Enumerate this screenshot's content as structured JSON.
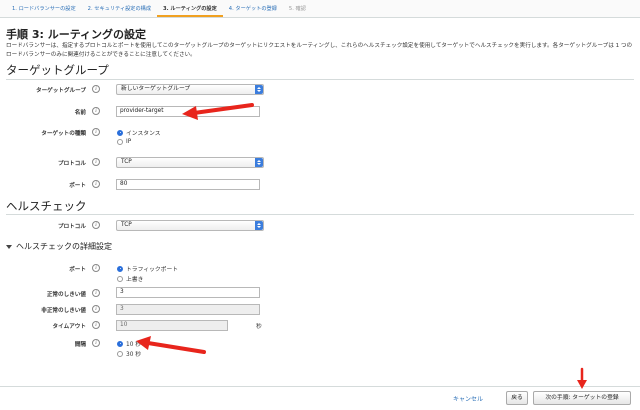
{
  "tabs": [
    {
      "label": "1. ロードバランサーの設定"
    },
    {
      "label": "2. セキュリティ設定の構成"
    },
    {
      "label": "3. ルーティングの設定"
    },
    {
      "label": "4. ターゲットの登録"
    },
    {
      "label": "5. 確認"
    }
  ],
  "page": {
    "title": "手順 3: ルーティングの設定",
    "description": "ロードバランサーは、指定するプロトコルとポートを使用してこのターゲットグループのターゲットにリクエストをルーティングし、これらのヘルスチェック設定を使用してターゲットでヘルスチェックを実行します。各ターゲットグループは 1 つのロードバランサーのみに関連付けることができることに注意してください。"
  },
  "target_group": {
    "section_title": "ターゲットグループ",
    "target_group_label": "ターゲットグループ",
    "target_group_value": "新しいターゲットグループ",
    "name_label": "名前",
    "name_value": "provider-target",
    "target_type_label": "ターゲットの種類",
    "target_type_options": [
      "インスタンス",
      "IP"
    ],
    "protocol_label": "プロトコル",
    "protocol_value": "TCP",
    "port_label": "ポート",
    "port_value": "80"
  },
  "health_check": {
    "section_title": "ヘルスチェック",
    "protocol_label": "プロトコル",
    "protocol_value": "TCP"
  },
  "advanced": {
    "title": "ヘルスチェックの詳細設定",
    "port_label": "ポート",
    "port_options": [
      "トラフィックポート",
      "上書き"
    ],
    "healthy_label": "正常のしきい値",
    "healthy_value": "3",
    "unhealthy_label": "非正常のしきい値",
    "unhealthy_value": "3",
    "timeout_label": "タイムアウト",
    "timeout_value": "10",
    "timeout_unit": "秒",
    "interval_label": "間隔",
    "interval_options": [
      "10 秒",
      "30 秒"
    ]
  },
  "footer": {
    "cancel_label": "キャンセル",
    "back_label": "戻る",
    "next_label": "次の手順: ターゲットの登録"
  },
  "colors": {
    "link": "#2a6fb7",
    "accent_tab": "#f0a020",
    "arrow": "#e8251c",
    "radio_selected": "#2a6fdb"
  }
}
